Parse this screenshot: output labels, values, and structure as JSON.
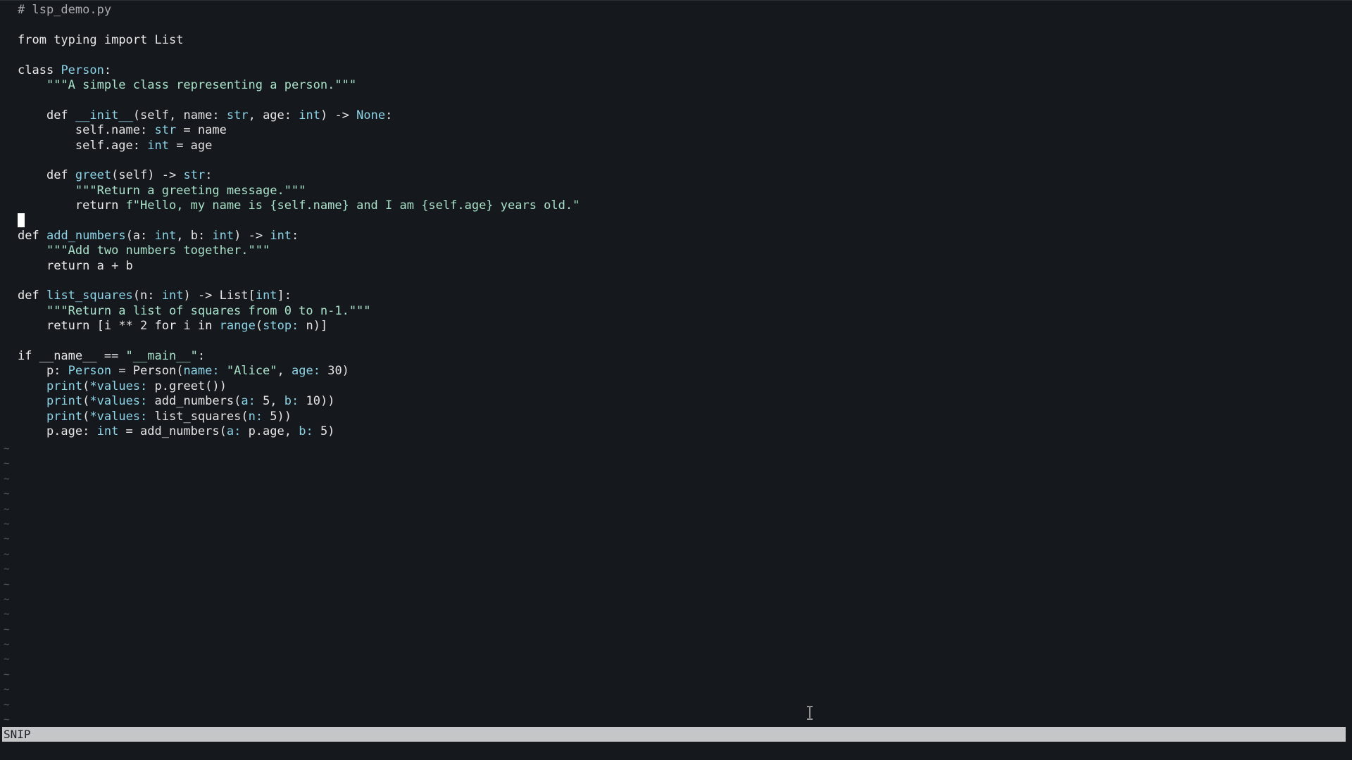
{
  "editor": {
    "filename": "lsp_demo.py",
    "mode": "SNIP"
  },
  "code": {
    "lines": [
      [
        {
          "t": "# lsp_demo.py",
          "c": "c-comment"
        }
      ],
      [],
      [
        {
          "t": "from",
          "c": "kw"
        },
        {
          "t": " typing ",
          "c": "c-plain"
        },
        {
          "t": "import",
          "c": "kw"
        },
        {
          "t": " List",
          "c": "c-plain"
        }
      ],
      [],
      [
        {
          "t": "class",
          "c": "kw"
        },
        {
          "t": " ",
          "c": "c-plain"
        },
        {
          "t": "Person",
          "c": "c-name"
        },
        {
          "t": ":",
          "c": "c-plain"
        }
      ],
      [
        {
          "t": "    ",
          "c": "c-plain"
        },
        {
          "t": "\"\"\"A simple class representing a person.\"\"\"",
          "c": "c-str"
        }
      ],
      [],
      [
        {
          "t": "    ",
          "c": "c-plain"
        },
        {
          "t": "def",
          "c": "kw"
        },
        {
          "t": " ",
          "c": "c-plain"
        },
        {
          "t": "__init__",
          "c": "c-name"
        },
        {
          "t": "(self, name: ",
          "c": "c-plain"
        },
        {
          "t": "str",
          "c": "c-name"
        },
        {
          "t": ", age: ",
          "c": "c-plain"
        },
        {
          "t": "int",
          "c": "c-name"
        },
        {
          "t": ") -> ",
          "c": "c-plain"
        },
        {
          "t": "None",
          "c": "c-name"
        },
        {
          "t": ":",
          "c": "c-plain"
        }
      ],
      [
        {
          "t": "        self.name: ",
          "c": "c-plain"
        },
        {
          "t": "str",
          "c": "c-name"
        },
        {
          "t": " = name",
          "c": "c-plain"
        }
      ],
      [
        {
          "t": "        self.age: ",
          "c": "c-plain"
        },
        {
          "t": "int",
          "c": "c-name"
        },
        {
          "t": " = age",
          "c": "c-plain"
        }
      ],
      [],
      [
        {
          "t": "    ",
          "c": "c-plain"
        },
        {
          "t": "def",
          "c": "kw"
        },
        {
          "t": " ",
          "c": "c-plain"
        },
        {
          "t": "greet",
          "c": "c-name"
        },
        {
          "t": "(self) -> ",
          "c": "c-plain"
        },
        {
          "t": "str",
          "c": "c-name"
        },
        {
          "t": ":",
          "c": "c-plain"
        }
      ],
      [
        {
          "t": "        ",
          "c": "c-plain"
        },
        {
          "t": "\"\"\"Return a greeting message.\"\"\"",
          "c": "c-str"
        }
      ],
      [
        {
          "t": "        ",
          "c": "c-plain"
        },
        {
          "t": "return",
          "c": "kw"
        },
        {
          "t": " ",
          "c": "c-plain"
        },
        {
          "t": "f\"Hello, my name is {self.name} and I am {self.age} years old.\"",
          "c": "c-str"
        }
      ],
      [],
      [
        {
          "t": "def",
          "c": "kw"
        },
        {
          "t": " ",
          "c": "c-plain"
        },
        {
          "t": "add_numbers",
          "c": "c-name"
        },
        {
          "t": "(a: ",
          "c": "c-plain"
        },
        {
          "t": "int",
          "c": "c-name"
        },
        {
          "t": ", b: ",
          "c": "c-plain"
        },
        {
          "t": "int",
          "c": "c-name"
        },
        {
          "t": ") -> ",
          "c": "c-plain"
        },
        {
          "t": "int",
          "c": "c-name"
        },
        {
          "t": ":",
          "c": "c-plain"
        }
      ],
      [
        {
          "t": "    ",
          "c": "c-plain"
        },
        {
          "t": "\"\"\"Add two numbers together.\"\"\"",
          "c": "c-str"
        }
      ],
      [
        {
          "t": "    ",
          "c": "c-plain"
        },
        {
          "t": "return",
          "c": "kw"
        },
        {
          "t": " a + b",
          "c": "c-plain"
        }
      ],
      [],
      [
        {
          "t": "def",
          "c": "kw"
        },
        {
          "t": " ",
          "c": "c-plain"
        },
        {
          "t": "list_squares",
          "c": "c-name"
        },
        {
          "t": "(n: ",
          "c": "c-plain"
        },
        {
          "t": "int",
          "c": "c-name"
        },
        {
          "t": ") -> List[",
          "c": "c-plain"
        },
        {
          "t": "int",
          "c": "c-name"
        },
        {
          "t": "]:",
          "c": "c-plain"
        }
      ],
      [
        {
          "t": "    ",
          "c": "c-plain"
        },
        {
          "t": "\"\"\"Return a list of squares from 0 to n-1.\"\"\"",
          "c": "c-str"
        }
      ],
      [
        {
          "t": "    ",
          "c": "c-plain"
        },
        {
          "t": "return",
          "c": "kw"
        },
        {
          "t": " [i ** 2 ",
          "c": "c-plain"
        },
        {
          "t": "for",
          "c": "kw"
        },
        {
          "t": " i ",
          "c": "c-plain"
        },
        {
          "t": "in",
          "c": "kw"
        },
        {
          "t": " ",
          "c": "c-plain"
        },
        {
          "t": "range",
          "c": "c-name"
        },
        {
          "t": "(",
          "c": "c-plain"
        },
        {
          "t": "stop:",
          "c": "c-name"
        },
        {
          "t": " n)]",
          "c": "c-plain"
        }
      ],
      [],
      [
        {
          "t": "if",
          "c": "kw"
        },
        {
          "t": " __name__ == ",
          "c": "c-plain"
        },
        {
          "t": "\"__main__\"",
          "c": "c-str"
        },
        {
          "t": ":",
          "c": "c-plain"
        }
      ],
      [
        {
          "t": "    p: ",
          "c": "c-plain"
        },
        {
          "t": "Person",
          "c": "c-name"
        },
        {
          "t": " = Person(",
          "c": "c-plain"
        },
        {
          "t": "name:",
          "c": "c-name"
        },
        {
          "t": " ",
          "c": "c-plain"
        },
        {
          "t": "\"Alice\"",
          "c": "c-str"
        },
        {
          "t": ", ",
          "c": "c-plain"
        },
        {
          "t": "age:",
          "c": "c-name"
        },
        {
          "t": " 30)",
          "c": "c-plain"
        }
      ],
      [
        {
          "t": "    ",
          "c": "c-plain"
        },
        {
          "t": "print",
          "c": "c-name"
        },
        {
          "t": "(",
          "c": "c-plain"
        },
        {
          "t": "*values:",
          "c": "c-name"
        },
        {
          "t": " p.greet())",
          "c": "c-plain"
        }
      ],
      [
        {
          "t": "    ",
          "c": "c-plain"
        },
        {
          "t": "print",
          "c": "c-name"
        },
        {
          "t": "(",
          "c": "c-plain"
        },
        {
          "t": "*values:",
          "c": "c-name"
        },
        {
          "t": " add_numbers(",
          "c": "c-plain"
        },
        {
          "t": "a:",
          "c": "c-name"
        },
        {
          "t": " 5, ",
          "c": "c-plain"
        },
        {
          "t": "b:",
          "c": "c-name"
        },
        {
          "t": " 10))",
          "c": "c-plain"
        }
      ],
      [
        {
          "t": "    ",
          "c": "c-plain"
        },
        {
          "t": "print",
          "c": "c-name"
        },
        {
          "t": "(",
          "c": "c-plain"
        },
        {
          "t": "*values:",
          "c": "c-name"
        },
        {
          "t": " list_squares(",
          "c": "c-plain"
        },
        {
          "t": "n:",
          "c": "c-name"
        },
        {
          "t": " 5))",
          "c": "c-plain"
        }
      ],
      [
        {
          "t": "    p.age: ",
          "c": "c-plain"
        },
        {
          "t": "int",
          "c": "c-name"
        },
        {
          "t": " = add_numbers(",
          "c": "c-plain"
        },
        {
          "t": "a:",
          "c": "c-name"
        },
        {
          "t": " p.age, ",
          "c": "c-plain"
        },
        {
          "t": "b:",
          "c": "c-name"
        },
        {
          "t": " 5)",
          "c": "c-plain"
        }
      ]
    ],
    "cursor_line": 14
  },
  "empty_line_marker": "~",
  "empty_line_count": 19
}
